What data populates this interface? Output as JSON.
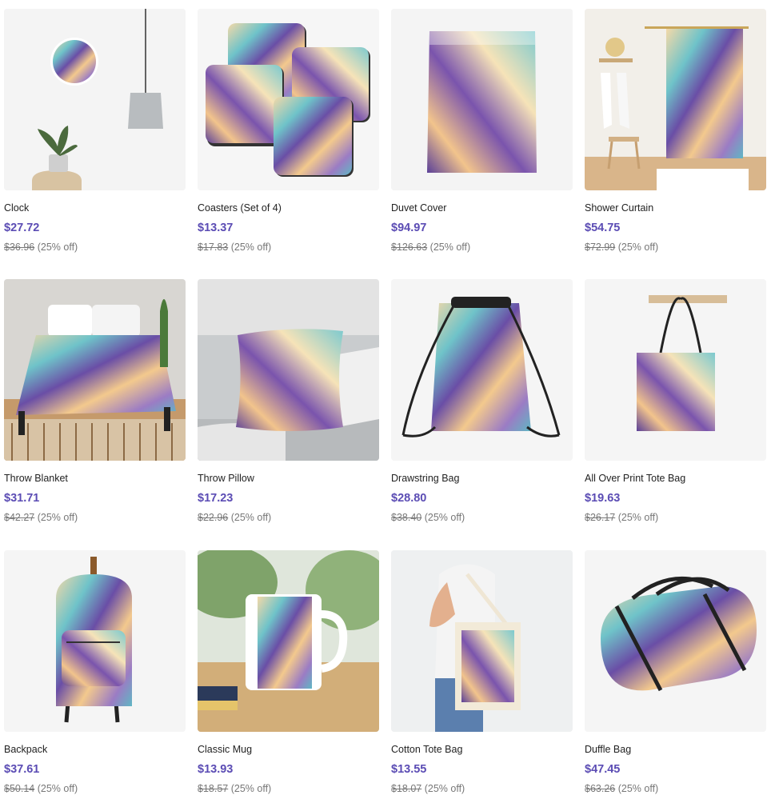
{
  "colors": {
    "accent": "#5b4cb4"
  },
  "products": [
    {
      "name": "Clock",
      "price": "$27.72",
      "original": "$36.96",
      "discount": "(25% off)",
      "image_icon": "clock-product-image"
    },
    {
      "name": "Coasters (Set of 4)",
      "price": "$13.37",
      "original": "$17.83",
      "discount": "(25% off)",
      "image_icon": "coasters-product-image"
    },
    {
      "name": "Duvet Cover",
      "price": "$94.97",
      "original": "$126.63",
      "discount": "(25% off)",
      "image_icon": "duvet-product-image"
    },
    {
      "name": "Shower Curtain",
      "price": "$54.75",
      "original": "$72.99",
      "discount": "(25% off)",
      "image_icon": "shower-curtain-product-image"
    },
    {
      "name": "Throw Blanket",
      "price": "$31.71",
      "original": "$42.27",
      "discount": "(25% off)",
      "image_icon": "throw-blanket-product-image"
    },
    {
      "name": "Throw Pillow",
      "price": "$17.23",
      "original": "$22.96",
      "discount": "(25% off)",
      "image_icon": "throw-pillow-product-image"
    },
    {
      "name": "Drawstring Bag",
      "price": "$28.80",
      "original": "$38.40",
      "discount": "(25% off)",
      "image_icon": "drawstring-bag-product-image"
    },
    {
      "name": "All Over Print Tote Bag",
      "price": "$19.63",
      "original": "$26.17",
      "discount": "(25% off)",
      "image_icon": "tote-bag-product-image"
    },
    {
      "name": "Backpack",
      "price": "$37.61",
      "original": "$50.14",
      "discount": "(25% off)",
      "image_icon": "backpack-product-image"
    },
    {
      "name": "Classic Mug",
      "price": "$13.93",
      "original": "$18.57",
      "discount": "(25% off)",
      "image_icon": "mug-product-image"
    },
    {
      "name": "Cotton Tote Bag",
      "price": "$13.55",
      "original": "$18.07",
      "discount": "(25% off)",
      "image_icon": "cotton-tote-product-image"
    },
    {
      "name": "Duffle Bag",
      "price": "$47.45",
      "original": "$63.26",
      "discount": "(25% off)",
      "image_icon": "duffle-bag-product-image"
    }
  ]
}
